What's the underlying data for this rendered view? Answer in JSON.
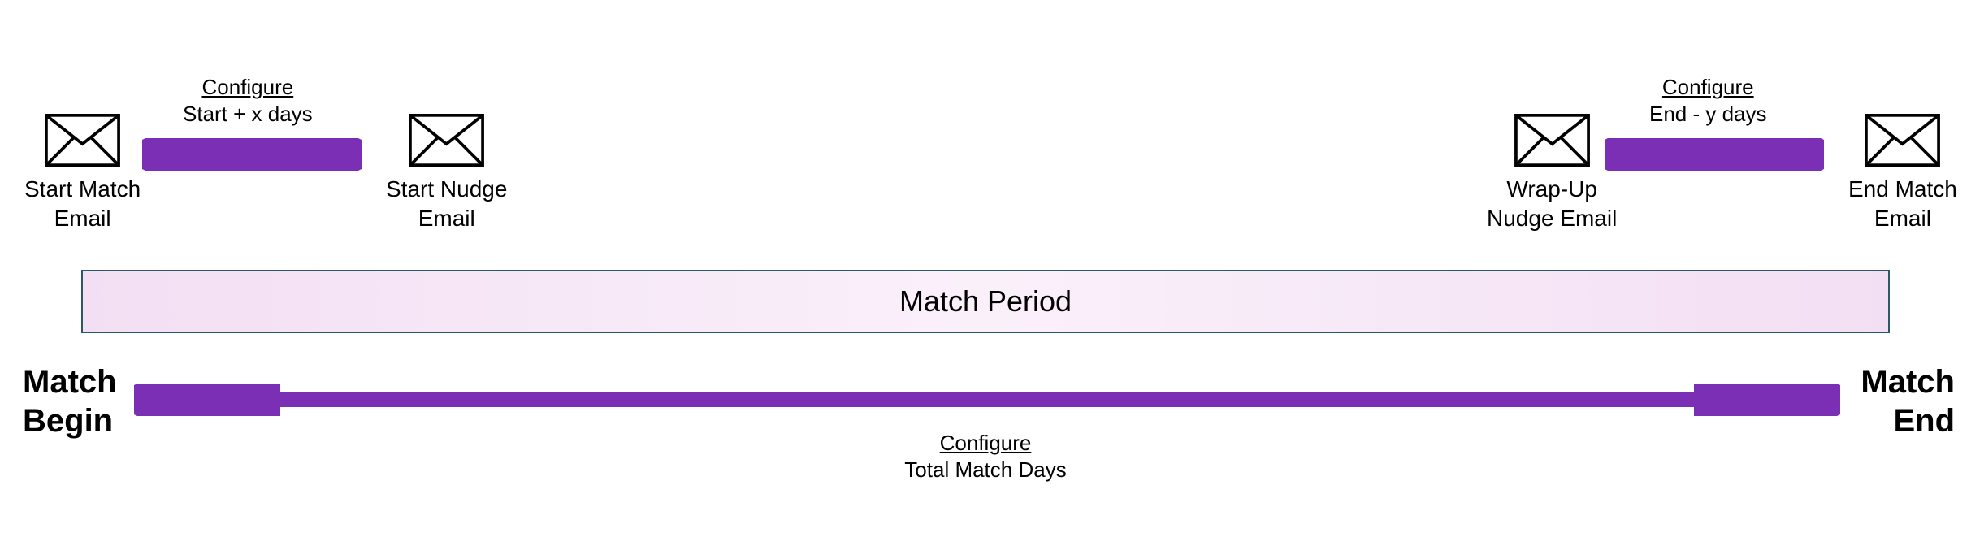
{
  "emails": {
    "start_match": {
      "line1": "Start Match",
      "line2": "Email"
    },
    "start_nudge": {
      "line1": "Start Nudge",
      "line2": "Email"
    },
    "wrapup_nudge": {
      "line1": "Wrap-Up",
      "line2": "Nudge Email"
    },
    "end_match": {
      "line1": "End Match",
      "line2": "Email"
    }
  },
  "configure": {
    "start_nudge": {
      "title": "Configure",
      "sub": "Start + x days"
    },
    "wrapup_nudge": {
      "title": "Configure",
      "sub": "End - y days"
    },
    "total": {
      "title": "Configure",
      "sub": "Total Match Days"
    }
  },
  "period": {
    "title": "Match Period",
    "begin_line1": "Match",
    "begin_line2": "Begin",
    "end_line1": "Match",
    "end_line2": "End"
  },
  "colors": {
    "arrow": "#7b2fb5",
    "bar_border": "#2a5a6a",
    "bar_fill_light": "#faf0fa",
    "bar_fill_edge": "#f3dff3"
  }
}
